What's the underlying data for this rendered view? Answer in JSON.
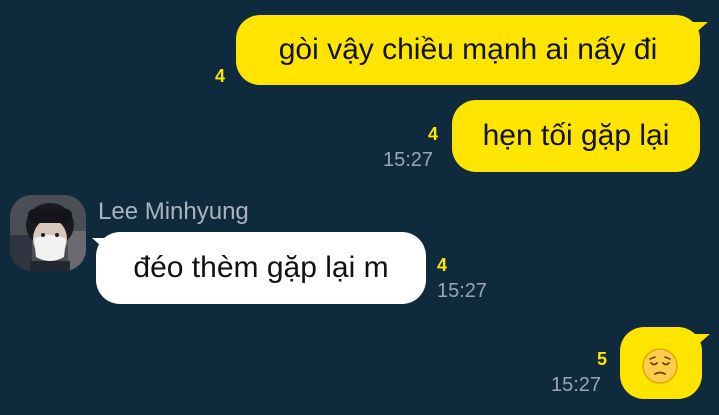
{
  "colors": {
    "background": "#0f2a3c",
    "my_bubble": "#fee500",
    "their_bubble": "#ffffff",
    "unread": "#fee500",
    "time": "#9aa7b2",
    "sender": "#a9b4be"
  },
  "messages": [
    {
      "side": "me",
      "text": "gòi vậy chiều mạnh ai nấy đi",
      "unread": "4",
      "time": ""
    },
    {
      "side": "me",
      "text": "hẹn tối gặp lại",
      "unread": "4",
      "time": "15:27"
    },
    {
      "side": "them",
      "sender": "Lee Minhyung",
      "text": "đéo thèm gặp lại m",
      "unread": "4",
      "time": "15:27"
    },
    {
      "side": "me",
      "text": "",
      "emoji": "pensive-face-emoji",
      "unread": "5",
      "time": "15:27"
    }
  ]
}
